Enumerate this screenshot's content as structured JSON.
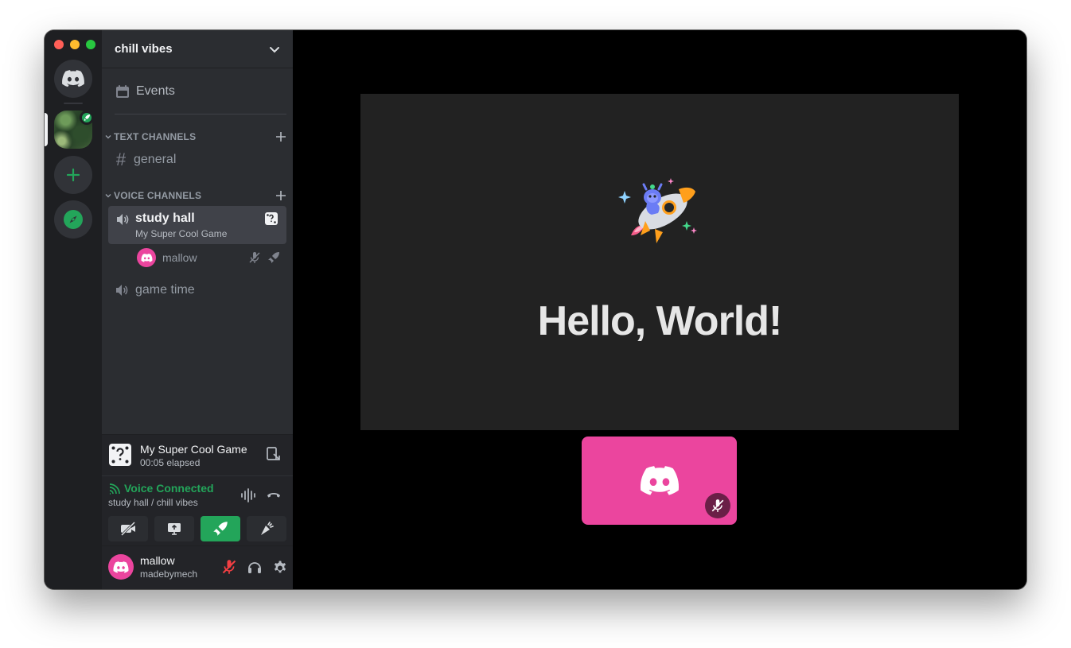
{
  "guild": {
    "name": "chill vibes"
  },
  "sidebar": {
    "events_label": "Events",
    "text_category": "TEXT CHANNELS",
    "voice_category": "VOICE CHANNELS",
    "text_channels": [
      {
        "name": "general"
      }
    ],
    "voice_channels": [
      {
        "name": "study hall",
        "activity": "My Super Cool Game",
        "users": [
          {
            "name": "mallow"
          }
        ]
      },
      {
        "name": "game time"
      }
    ]
  },
  "activity_bar": {
    "title": "My Super Cool Game",
    "elapsed": "00:05 elapsed"
  },
  "voice_panel": {
    "status": "Voice Connected",
    "location": "study hall / chill vibes"
  },
  "user_panel": {
    "name": "mallow",
    "tag": "madebymech"
  },
  "stage": {
    "heading": "Hello, World!"
  },
  "colors": {
    "brand": "#5865f2",
    "green": "#23a55a",
    "pink": "#eb459e",
    "red": "#f23f43",
    "sidebar": "#2b2d31",
    "rail": "#1e1f22"
  }
}
